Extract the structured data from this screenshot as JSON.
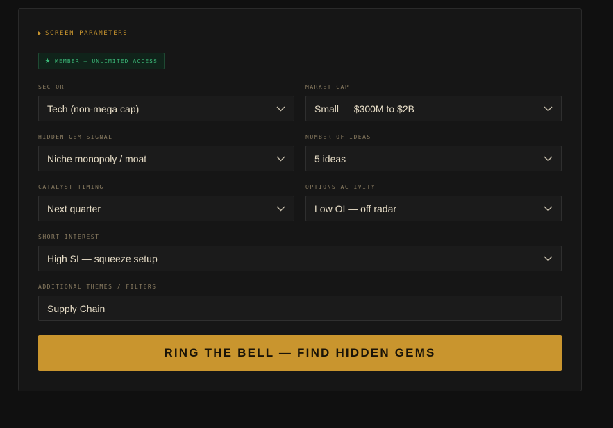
{
  "form": {
    "section_title": "SCREEN PARAMETERS",
    "badge": {
      "icon": "star-icon",
      "label": "MEMBER — UNLIMITED ACCESS"
    },
    "fields": {
      "sector": {
        "label": "SECTOR",
        "value": "Tech (non-mega cap)"
      },
      "market_cap": {
        "label": "MARKET CAP",
        "value": "Small — $300M to $2B"
      },
      "hidden_gem_signal": {
        "label": "HIDDEN GEM SIGNAL",
        "value": "Niche monopoly / moat"
      },
      "number_of_ideas": {
        "label": "NUMBER OF IDEAS",
        "value": "5 ideas"
      },
      "catalyst_timing": {
        "label": "CATALYST TIMING",
        "value": "Next quarter"
      },
      "options_activity": {
        "label": "OPTIONS ACTIVITY",
        "value": "Low OI — off radar"
      },
      "short_interest": {
        "label": "SHORT INTEREST",
        "value": "High SI — squeeze setup"
      },
      "additional_themes": {
        "label": "ADDITIONAL THEMES / FILTERS",
        "value": "Supply Chain"
      }
    },
    "submit_label": "RING THE BELL — FIND HIDDEN GEMS"
  },
  "colors": {
    "accent": "#c9952e",
    "member_green": "#3bb878",
    "background": "#101010",
    "panel": "#161616"
  }
}
